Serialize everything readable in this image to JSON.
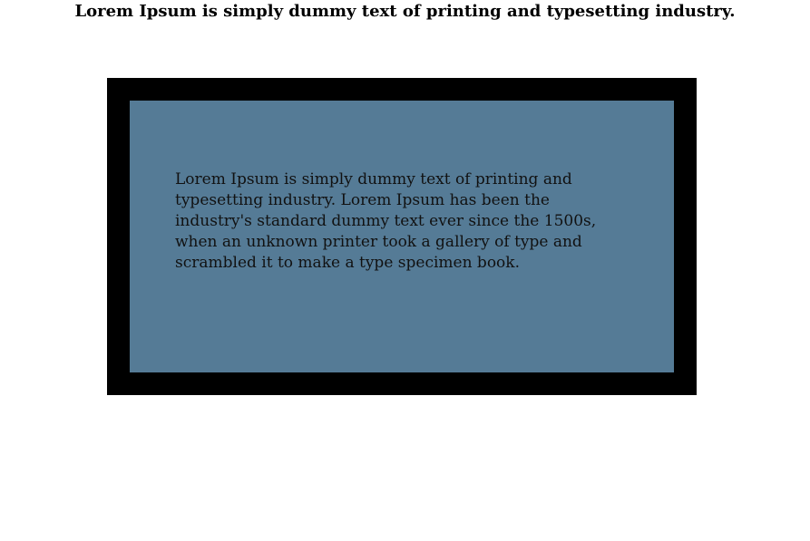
{
  "heading": "Lorem Ipsum is simply dummy text of printing and typesetting industry.",
  "panel": {
    "text": "Lorem Ipsum is simply dummy text of printing and typesetting industry. Lorem Ipsum has been the industry's standard dummy text ever since the 1500s, when an unknown printer took a gallery of type and scrambled it to make a type specimen book."
  },
  "colors": {
    "page_background": "#ffffff",
    "frame_border": "#000000",
    "panel_background": "#557b96",
    "text": "#111111"
  }
}
